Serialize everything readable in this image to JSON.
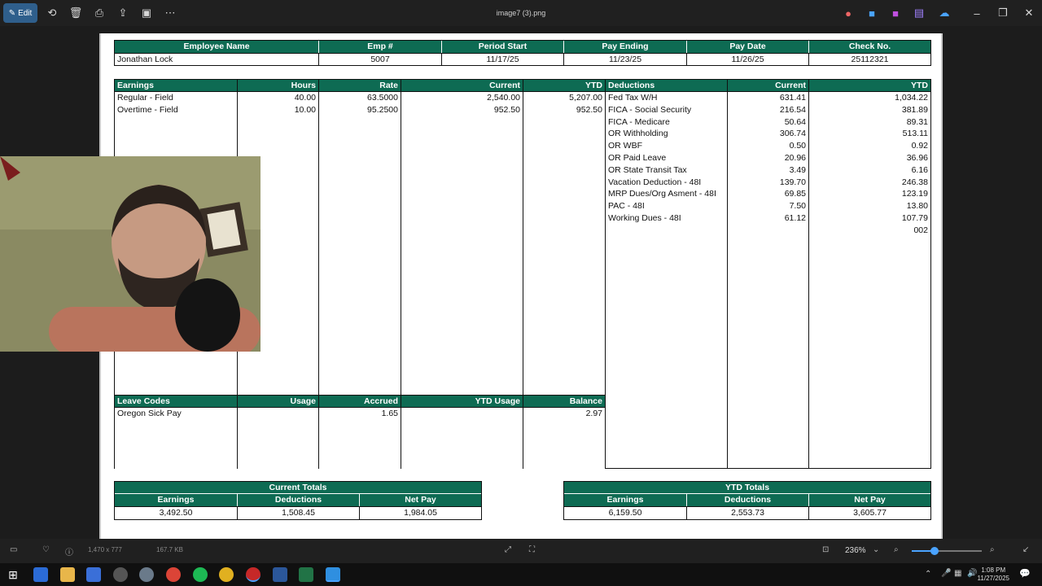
{
  "app": {
    "title": "image7 (3).png",
    "edit_label": "Edit",
    "zoom": "236%",
    "status_dims": "1,470 x 777",
    "status_size": "167.7 KB",
    "clock_time": "1:08 PM",
    "clock_date": "11/27/2025"
  },
  "header": {
    "columns": [
      "Employee Name",
      "Emp #",
      "Period Start",
      "Pay Ending",
      "Pay Date",
      "Check No."
    ],
    "values": [
      "Jonathan Lock",
      "5007",
      "11/17/25",
      "11/23/25",
      "11/26/25",
      "25112321"
    ]
  },
  "earnings": {
    "columns": [
      "Earnings",
      "Hours",
      "Rate",
      "Current",
      "YTD"
    ],
    "rows": [
      [
        "Regular - Field",
        "40.00",
        "63.5000",
        "2,540.00",
        "5,207.00"
      ],
      [
        "Overtime - Field",
        "10.00",
        "95.2500",
        "952.50",
        "952.50"
      ]
    ]
  },
  "deductions": {
    "columns": [
      "Deductions",
      "Current",
      "YTD"
    ],
    "rows": [
      [
        "Fed Tax W/H",
        "631.41",
        "1,034.22"
      ],
      [
        "FICA - Social Security",
        "216.54",
        "381.89"
      ],
      [
        "FICA - Medicare",
        "50.64",
        "89.31"
      ],
      [
        "OR Withholding",
        "306.74",
        "513.11"
      ],
      [
        "OR WBF",
        "0.50",
        "0.92"
      ],
      [
        "OR Paid Leave",
        "20.96",
        "36.96"
      ],
      [
        "OR State Transit Tax",
        "3.49",
        "6.16"
      ],
      [
        "Vacation Deduction - 48I",
        "139.70",
        "246.38"
      ],
      [
        "MRP Dues/Org Asment - 48I",
        "69.85",
        "123.19"
      ],
      [
        "PAC - 48I",
        "7.50",
        "13.80"
      ],
      [
        "Working Dues - 48I",
        "61.12",
        "107.79"
      ],
      [
        "",
        "",
        "002"
      ]
    ]
  },
  "leave": {
    "columns": [
      "Leave Codes",
      "Usage",
      "Accrued",
      "YTD Usage",
      "Balance"
    ],
    "rows": [
      [
        "Oregon Sick Pay",
        "",
        "1.65",
        "",
        "2.97"
      ]
    ]
  },
  "current_totals": {
    "title": "Current Totals",
    "columns": [
      "Earnings",
      "Deductions",
      "Net Pay"
    ],
    "values": [
      "3,492.50",
      "1,508.45",
      "1,984.05"
    ]
  },
  "ytd_totals": {
    "title": "YTD Totals",
    "columns": [
      "Earnings",
      "Deductions",
      "Net Pay"
    ],
    "values": [
      "6,159.50",
      "2,553.73",
      "3,605.77"
    ]
  }
}
